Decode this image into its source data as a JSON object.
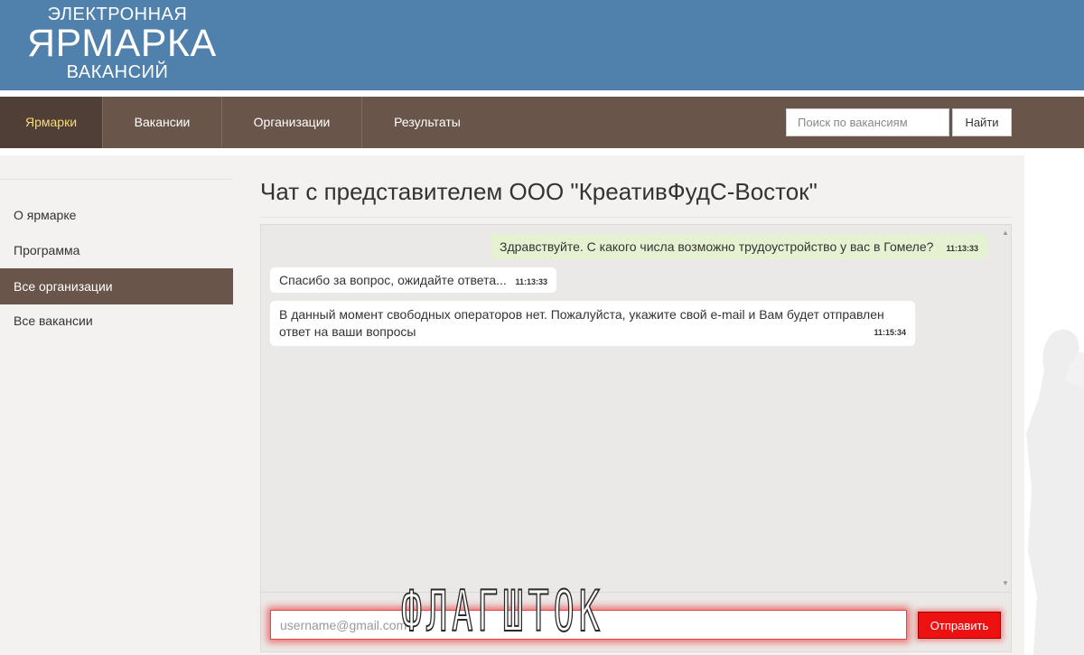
{
  "header": {
    "logo_line1": "ЭЛЕКТРОННАЯ",
    "logo_line2": "ЯРМАРКА",
    "logo_line3": "ВАКАНСИЙ",
    "bg_color": "#5080ac"
  },
  "nav": {
    "items": [
      {
        "label": "Ярмарки",
        "active": true
      },
      {
        "label": "Вакансии",
        "active": false
      },
      {
        "label": "Организации",
        "active": false
      },
      {
        "label": "Результаты",
        "active": false
      }
    ],
    "search_placeholder": "Поиск по вакансиям",
    "search_button": "Найти",
    "bg_color": "#6a554b",
    "active_color": "#f6d979"
  },
  "sidebar": {
    "items": [
      {
        "label": "О ярмарке",
        "active": false
      },
      {
        "label": "Программа",
        "active": false
      },
      {
        "label": "Все организации",
        "active": true
      },
      {
        "label": "Все вакансии",
        "active": false
      }
    ]
  },
  "main": {
    "title": "Чат с представителем ООО \"КреативФудС-Восток\""
  },
  "chat": {
    "messages": [
      {
        "direction": "out",
        "text": "Здравствуйте. С какого числа возможно трудоустройство у вас в Гомеле?",
        "time": "11:13:33"
      },
      {
        "direction": "in",
        "text": "Спасибо за вопрос, ожидайте ответа...",
        "time": "11:13:33"
      },
      {
        "direction": "in",
        "text_line1": "В данный момент свободных операторов нет. Пожалуйста, укажите свой e-mail и Вам будет отправлен",
        "text_line2": "ответ на ваши вопросы",
        "time": "11:15:34"
      }
    ],
    "email_placeholder": "username@gmail.com",
    "send_button": "Отправить",
    "send_color": "#ee1111"
  },
  "watermark": {
    "text": "ФЛАГШТОК"
  }
}
